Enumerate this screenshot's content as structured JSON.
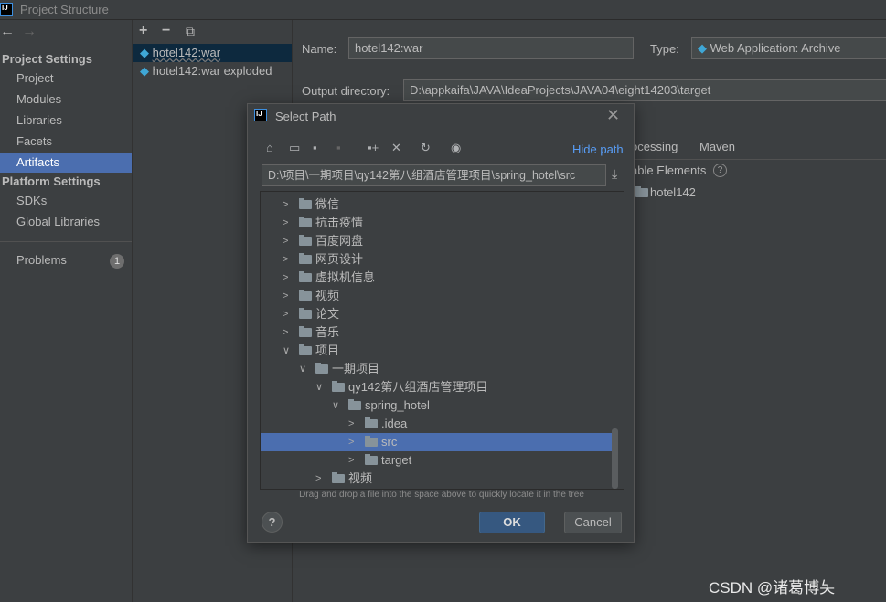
{
  "window": {
    "title": "Project Structure"
  },
  "sidebar": {
    "project_settings": "Project Settings",
    "items": [
      {
        "label": "Project"
      },
      {
        "label": "Modules"
      },
      {
        "label": "Libraries"
      },
      {
        "label": "Facets"
      },
      {
        "label": "Artifacts",
        "selected": true
      }
    ],
    "platform_settings": "Platform Settings",
    "platform_items": [
      {
        "label": "SDKs"
      },
      {
        "label": "Global Libraries"
      }
    ],
    "problems": {
      "label": "Problems",
      "count": "1"
    }
  },
  "artifacts": {
    "items": [
      {
        "label": "hotel142:war",
        "selected": true
      },
      {
        "label": "hotel142:war exploded"
      }
    ]
  },
  "main": {
    "name_label": "Name:",
    "name_value": "hotel142:war",
    "type_label": "Type:",
    "type_value": "Web Application: Archive",
    "output_label": "Output directory:",
    "output_value": "D:\\appkaifa\\JAVA\\IdeaProjects\\JAVA04\\eight14203\\target",
    "tabs": [
      "ocessing",
      "Maven"
    ],
    "available_elements": "able Elements",
    "tree_item": "hotel142"
  },
  "dialog": {
    "title": "Select Path",
    "hide_path": "Hide path",
    "path": "D:\\项目\\一期项目\\qy142第八组酒店管理项目\\spring_hotel\\src",
    "tree": [
      {
        "label": "微信",
        "level": 0,
        "expanded": false
      },
      {
        "label": "抗击疫情",
        "level": 0,
        "expanded": false
      },
      {
        "label": "百度网盘",
        "level": 0,
        "expanded": false
      },
      {
        "label": "网页设计",
        "level": 0,
        "expanded": false
      },
      {
        "label": "虚拟机信息",
        "level": 0,
        "expanded": false
      },
      {
        "label": "视频",
        "level": 0,
        "expanded": false
      },
      {
        "label": "论文",
        "level": 0,
        "expanded": false
      },
      {
        "label": "音乐",
        "level": 0,
        "expanded": false
      },
      {
        "label": "项目",
        "level": 0,
        "expanded": true
      },
      {
        "label": "一期项目",
        "level": 1,
        "expanded": true
      },
      {
        "label": "qy142第八组酒店管理项目",
        "level": 2,
        "expanded": true
      },
      {
        "label": "spring_hotel",
        "level": 3,
        "expanded": true
      },
      {
        "label": ".idea",
        "level": 4,
        "expanded": false
      },
      {
        "label": "src",
        "level": 4,
        "expanded": false,
        "selected": true
      },
      {
        "label": "target",
        "level": 4,
        "expanded": false
      },
      {
        "label": "视频",
        "level": 2,
        "expanded": false
      }
    ],
    "hint": "Drag and drop a file into the space above to quickly locate it in the tree",
    "ok": "OK",
    "cancel": "Cancel",
    "help": "?"
  },
  "watermark": "CSDN @诸葛博夨",
  "colors": {
    "selection": "#4b6eaf",
    "link": "#589df6",
    "ok_button": "#365880"
  }
}
